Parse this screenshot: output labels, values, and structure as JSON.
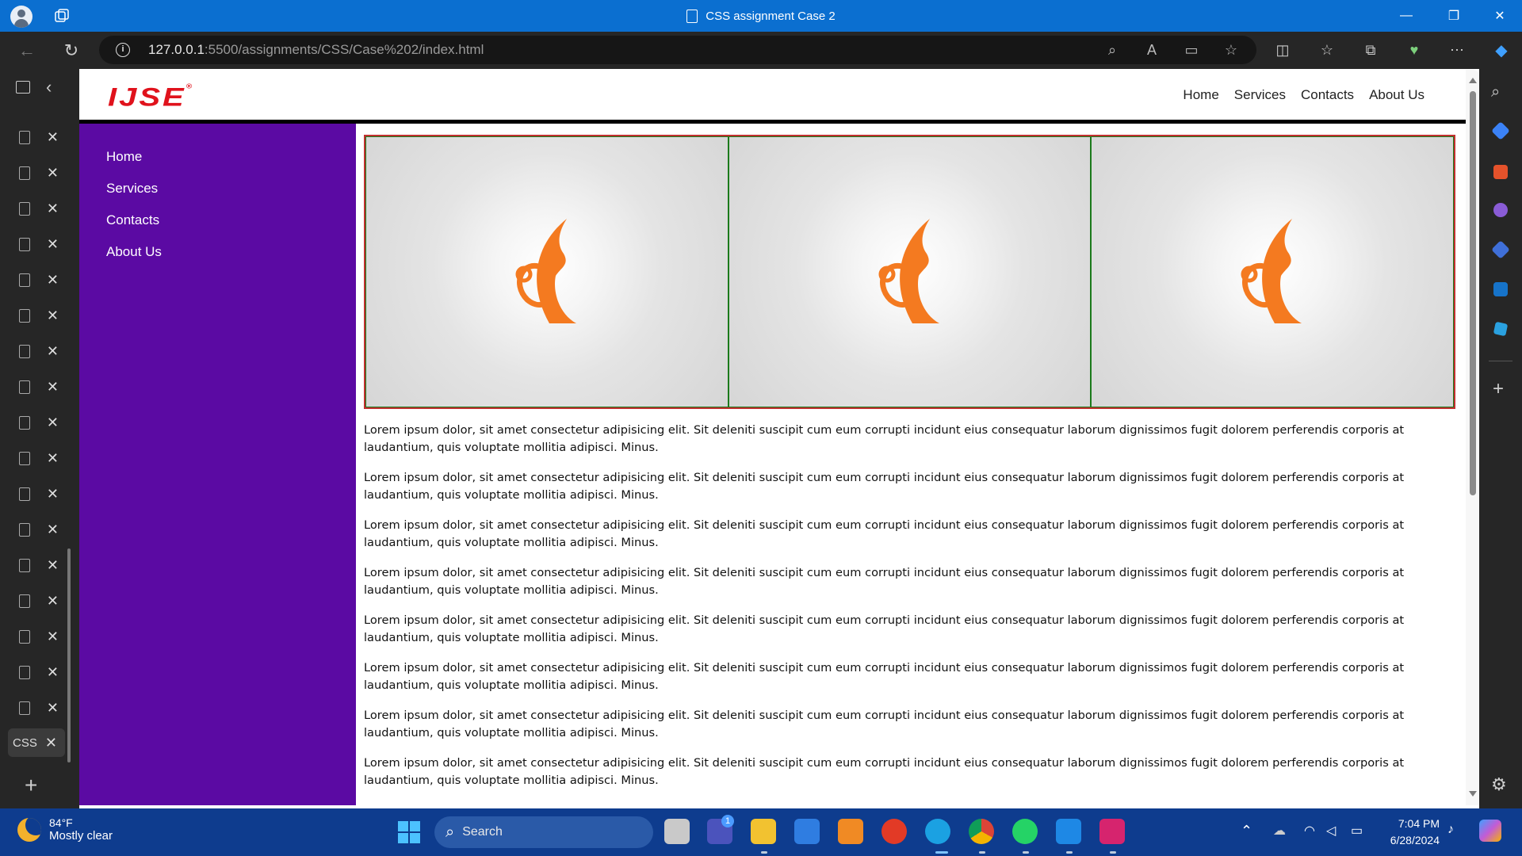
{
  "window": {
    "title": "CSS assignment Case 2"
  },
  "addressbar": {
    "url_host": "127.0.0.1",
    "url_path": ":5500/assignments/CSS/Case%202/index.html"
  },
  "vertical_tabs": {
    "active_label": "CSS"
  },
  "site": {
    "logo_text": "IJSE",
    "logo_reg": "®",
    "top_nav": [
      "Home",
      "Services",
      "Contacts",
      "About Us"
    ],
    "side_nav": [
      "Home",
      "Services",
      "Contacts",
      "About Us"
    ],
    "paragraphs": [
      "Lorem ipsum dolor, sit amet consectetur adipisicing elit. Sit deleniti suscipit cum eum corrupti incidunt eius consequatur laborum dignissimos fugit dolorem perferendis corporis at laudantium, quis voluptate mollitia adipisci. Minus.",
      "Lorem ipsum dolor, sit amet consectetur adipisicing elit. Sit deleniti suscipit cum eum corrupti incidunt eius consequatur laborum dignissimos fugit dolorem perferendis corporis at laudantium, quis voluptate mollitia adipisci. Minus.",
      "Lorem ipsum dolor, sit amet consectetur adipisicing elit. Sit deleniti suscipit cum eum corrupti incidunt eius consequatur laborum dignissimos fugit dolorem perferendis corporis at laudantium, quis voluptate mollitia adipisci. Minus.",
      "Lorem ipsum dolor, sit amet consectetur adipisicing elit. Sit deleniti suscipit cum eum corrupti incidunt eius consequatur laborum dignissimos fugit dolorem perferendis corporis at laudantium, quis voluptate mollitia adipisci. Minus.",
      "Lorem ipsum dolor, sit amet consectetur adipisicing elit. Sit deleniti suscipit cum eum corrupti incidunt eius consequatur laborum dignissimos fugit dolorem perferendis corporis at laudantium, quis voluptate mollitia adipisci. Minus.",
      "Lorem ipsum dolor, sit amet consectetur adipisicing elit. Sit deleniti suscipit cum eum corrupti incidunt eius consequatur laborum dignissimos fugit dolorem perferendis corporis at laudantium, quis voluptate mollitia adipisci. Minus.",
      "Lorem ipsum dolor, sit amet consectetur adipisicing elit. Sit deleniti suscipit cum eum corrupti incidunt eius consequatur laborum dignissimos fugit dolorem perferendis corporis at laudantium, quis voluptate mollitia adipisci. Minus.",
      "Lorem ipsum dolor, sit amet consectetur adipisicing elit. Sit deleniti suscipit cum eum corrupti incidunt eius consequatur laborum dignissimos fugit dolorem perferendis corporis at laudantium, quis voluptate mollitia adipisci. Minus."
    ]
  },
  "taskbar": {
    "weather_temp": "84°F",
    "weather_desc": "Mostly clear",
    "search_label": "Search",
    "teams_badge": "1",
    "clock_time": "7:04 PM",
    "clock_date": "6/28/2024"
  },
  "colors": {
    "sidebar": "#5b0aa3",
    "logo": "#e0121c",
    "titlebar": "#0b6fd0",
    "taskbar": "#0e3c8e"
  }
}
